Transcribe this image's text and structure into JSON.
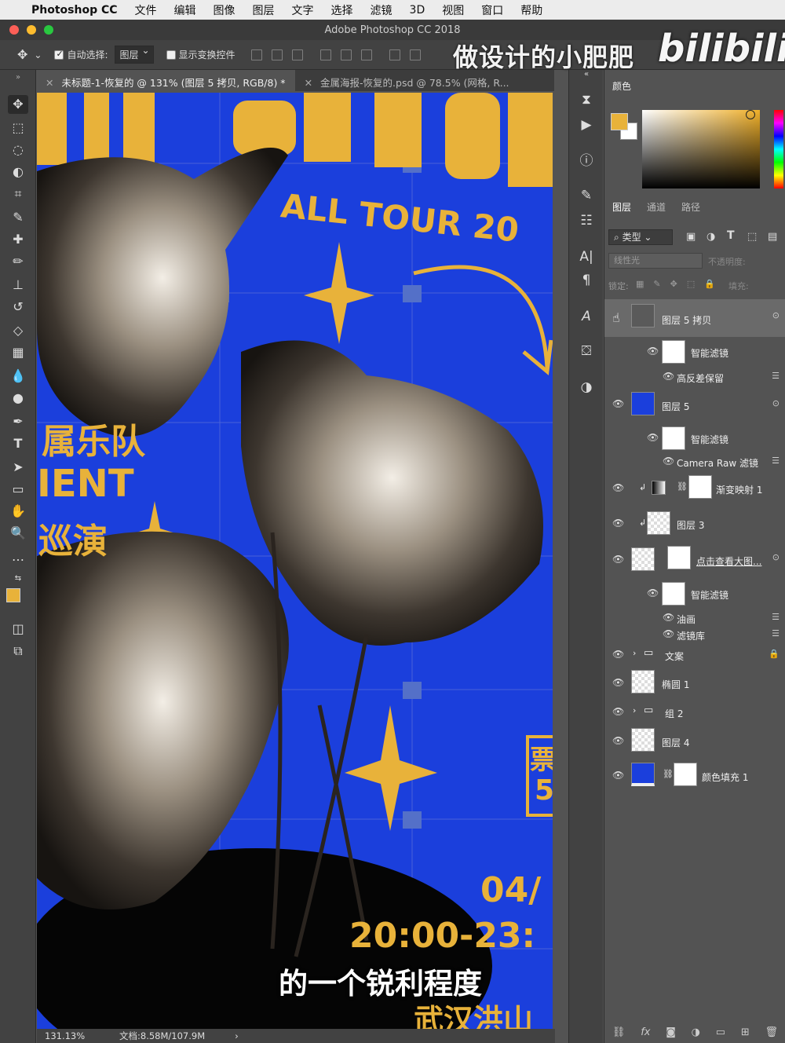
{
  "menubar": {
    "app": "Photoshop CC",
    "items": [
      "文件",
      "编辑",
      "图像",
      "图层",
      "文字",
      "选择",
      "滤镜",
      "3D",
      "视图",
      "窗口",
      "帮助"
    ]
  },
  "window": {
    "title": "Adobe Photoshop CC 2018"
  },
  "options_bar": {
    "auto_select_label": "自动选择:",
    "auto_select_value": "图层",
    "show_transform_label": "显示变换控件"
  },
  "watermark": {
    "text": "做设计的小肥肥",
    "logo": "bilibili"
  },
  "tabs": [
    {
      "label": "未标题-1-恢复的 @ 131% (图层 5 拷贝, RGB/8) *",
      "active": true
    },
    {
      "label": "金属海报-恢复的.psd @ 78.5% (网格, R...",
      "active": false
    }
  ],
  "poster": {
    "tour_text": "ALL TOUR 20",
    "cn_band": "属乐队",
    "en_text": "IENT",
    "cn_tour": "巡演",
    "ticket_cn": "票",
    "ticket_num": "5",
    "date": "04/",
    "time": "20:00-23:",
    "venue": "武汉洪山",
    "bg_color": "#1b3fdc",
    "accent_color": "#e8b23a"
  },
  "subtitle": "的一个锐利程度",
  "status": {
    "zoom": "131.13%",
    "doc": "文档:8.58M/107.9M"
  },
  "color_panel": {
    "title": "颜色",
    "fg": "#e8b23a",
    "bg": "#ffffff"
  },
  "layers_panel": {
    "tabs": [
      "图层",
      "通道",
      "路径"
    ],
    "filter_kind": "类型",
    "blend_mode": "线性光",
    "opacity_label": "不透明度:",
    "lock_label": "锁定:",
    "fill_label": "填充:",
    "layers": [
      {
        "name": "图层 5 拷贝",
        "selected": true
      },
      {
        "name": "智能滤镜",
        "sub": true
      },
      {
        "name": "高反差保留",
        "filter": true
      },
      {
        "name": "图层 5"
      },
      {
        "name": "智能滤镜",
        "sub": true
      },
      {
        "name": "Camera Raw 滤镜",
        "filter": true
      },
      {
        "name": "渐变映射 1"
      },
      {
        "name": "图层 3"
      },
      {
        "name": "点击查看大图..."
      },
      {
        "name": "智能滤镜",
        "sub": true
      },
      {
        "name": "油画",
        "filter": true
      },
      {
        "name": "滤镜库",
        "filter": true
      },
      {
        "name": "文案",
        "group": true
      },
      {
        "name": "椭圆 1"
      },
      {
        "name": "组 2",
        "group": true
      },
      {
        "name": "图层 4"
      },
      {
        "name": "颜色填充 1"
      }
    ]
  }
}
